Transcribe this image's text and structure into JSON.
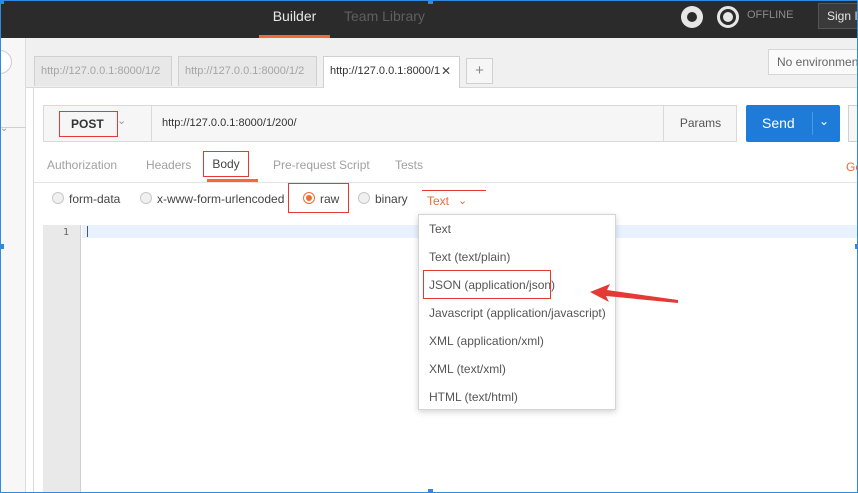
{
  "topbar": {
    "tabs": [
      {
        "label": "Builder",
        "active": true
      },
      {
        "label": "Team Library",
        "active": false
      }
    ],
    "status": "OFFLINE",
    "signin": "Sign In"
  },
  "request_tabs": [
    {
      "url": "http://127.0.0.1:8000/1/2",
      "active": false
    },
    {
      "url": "http://127.0.0.1:8000/1/2",
      "active": false
    },
    {
      "url": "http://127.0.0.1:8000/1",
      "active": true,
      "close": "✕"
    }
  ],
  "add_tab": "+",
  "environment": "No environment",
  "request": {
    "method": "POST",
    "method_chevron": "⌄",
    "url": "http://127.0.0.1:8000/1/200/",
    "params_label": "Params",
    "send_label": "Send",
    "send_chevron": "⌄"
  },
  "sections": {
    "tabs": [
      "Authorization",
      "Headers",
      "Body",
      "Pre-request Script",
      "Tests"
    ],
    "active": "Body",
    "generate_code_fragment": "Ge"
  },
  "body_types": [
    {
      "label": "form-data",
      "checked": false
    },
    {
      "label": "x-www-form-urlencoded",
      "checked": false
    },
    {
      "label": "raw",
      "checked": true
    },
    {
      "label": "binary",
      "checked": false
    }
  ],
  "raw_format": {
    "selected": "Text",
    "chevron": "⌄"
  },
  "format_menu": {
    "items": [
      "Text",
      "Text (text/plain)",
      "JSON (application/json)",
      "Javascript (application/javascript)",
      "XML (application/xml)",
      "XML (text/xml)",
      "HTML (text/html)"
    ],
    "highlighted": "JSON (application/json)"
  },
  "editor": {
    "line_numbers": [
      "1"
    ]
  },
  "colors": {
    "accent": "#ef6c35",
    "send": "#1f7bd8",
    "annotation": "#e53935",
    "topbar": "#2b2b2b"
  },
  "icons": [
    "interceptor-icon",
    "sync-icon",
    "chevron-down-icon",
    "close-icon",
    "plus-icon",
    "arrow-annotation-icon"
  ]
}
